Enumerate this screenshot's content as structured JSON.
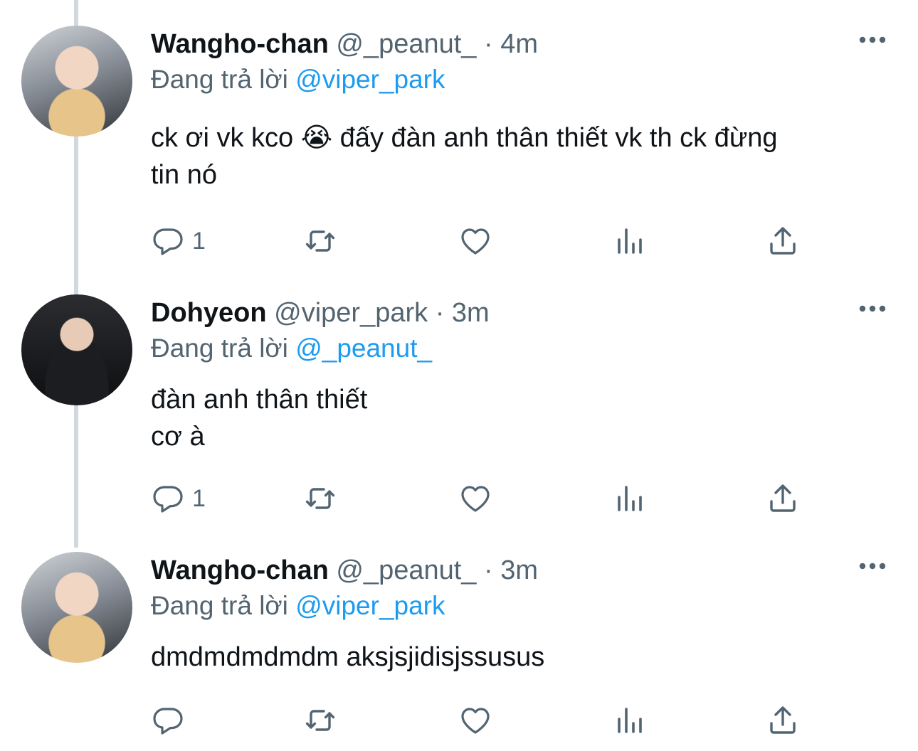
{
  "reply_prefix": "Đang trả lời",
  "tweets": [
    {
      "avatar": "profile-photo",
      "name": "Wangho-chan",
      "handle": "@_peanut_",
      "separator": "·",
      "time": "4m",
      "replying_to": "@viper_park",
      "text": "ck ơi vk kco 😭  đấy đàn anh thân thiết vk th ck đừng\ntin nó",
      "reply_count": "1"
    },
    {
      "avatar": "profile-photo",
      "name": "Dohyeon",
      "handle": "@viper_park",
      "separator": "·",
      "time": "3m",
      "replying_to": "@_peanut_",
      "text": "đàn anh thân thiết\ncơ à",
      "reply_count": "1"
    },
    {
      "avatar": "profile-photo",
      "name": "Wangho-chan",
      "handle": "@_peanut_",
      "separator": "·",
      "time": "3m",
      "replying_to": "@viper_park",
      "text": "dmdmdmdmdm aksjsjidisjssusus",
      "reply_count": ""
    }
  ],
  "icons": [
    "more-icon",
    "reply-icon",
    "retweet-icon",
    "like-icon",
    "analytics-icon",
    "share-icon"
  ],
  "colors": {
    "text": "#0f1419",
    "secondary": "#536471",
    "link": "#1d9bf0",
    "thread_line": "#cfd9de"
  }
}
